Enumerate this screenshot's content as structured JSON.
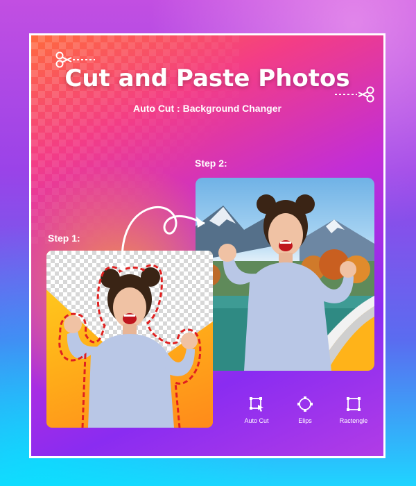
{
  "header": {
    "title": "Cut and Paste Photos",
    "subtitle": "Auto Cut : Background Changer"
  },
  "steps": {
    "step1_label": "Step 1:",
    "step2_label": "Step 2:"
  },
  "tools": [
    {
      "label": "Auto Cut",
      "icon": "auto-cut-icon"
    },
    {
      "label": "Elips",
      "icon": "ellipse-icon"
    },
    {
      "label": "Ractengle",
      "icon": "rectangle-icon"
    }
  ],
  "colors": {
    "accent": "#ffffff",
    "cut_line": "#e02020",
    "card1_bg": "#ffc21a"
  }
}
